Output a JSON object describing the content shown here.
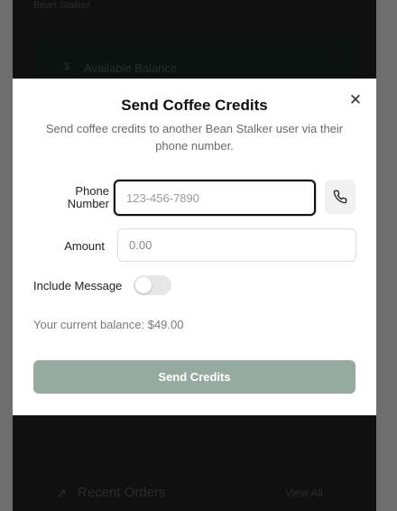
{
  "background": {
    "header_text": "Bean Stalker",
    "balance_card": {
      "label": "Available Balance",
      "icon": "wallet-icon"
    },
    "orders": {
      "title": "Recent Orders",
      "icon": "trend-icon",
      "view_all": "View All"
    }
  },
  "modal": {
    "title": "Send Coffee Credits",
    "subtitle": "Send coffee credits to another Bean Stalker user via their phone number.",
    "close_icon": "close-icon",
    "phone": {
      "label": "Phone Number",
      "placeholder": "123-456-7890",
      "value": "",
      "icon": "phone-icon"
    },
    "amount": {
      "label": "Amount",
      "placeholder": "0.00",
      "value": ""
    },
    "message": {
      "label": "Include Message",
      "enabled": false
    },
    "balance_text": "Your current balance: $49.00",
    "submit_label": "Send Credits"
  },
  "colors": {
    "accent": "#96aa9f",
    "overlay": "#000000",
    "text": "#111111"
  }
}
